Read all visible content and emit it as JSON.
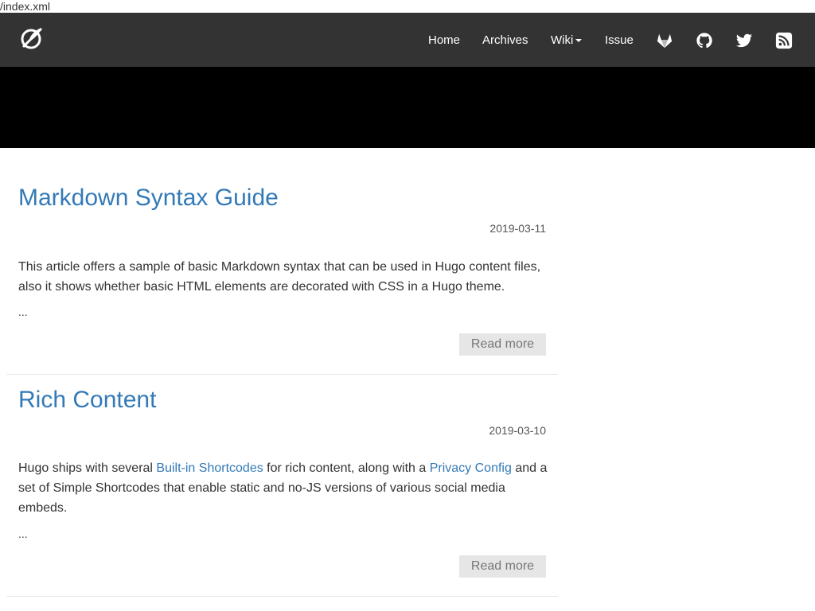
{
  "url_text": "/index.xml",
  "navbar": {
    "brand_icon": "no-smoking-quill-logo",
    "links": {
      "home": "Home",
      "archives": "Archives",
      "wiki": "Wiki",
      "issue": "Issue"
    },
    "icons": [
      "gitlab-icon",
      "github-icon",
      "twitter-icon",
      "rss-icon"
    ],
    "background": "#333333"
  },
  "hero": {
    "background": "#000000"
  },
  "posts": [
    {
      "title": "Markdown Syntax Guide",
      "date": "2019-03-11",
      "summary": "This article offers a sample of basic Markdown syntax that can be used in Hugo content files, also it shows whether basic HTML elements are decorated with CSS in a Hugo theme.",
      "ellipsis": "...",
      "read_more": "Read more"
    },
    {
      "title": "Rich Content",
      "date": "2019-03-10",
      "summary_part1": "Hugo ships with several ",
      "summary_link1": "Built-in Shortcodes",
      "summary_part2": " for rich content, along with a ",
      "summary_link2": "Privacy Config",
      "summary_part3": " and a set of Simple Shortcodes that enable static and no-JS versions of various social media embeds.",
      "ellipsis": "...",
      "read_more": "Read more"
    }
  ],
  "colors": {
    "link": "#337ab7",
    "read_more_bg": "#e6e6e6",
    "read_more_text": "#777777"
  }
}
